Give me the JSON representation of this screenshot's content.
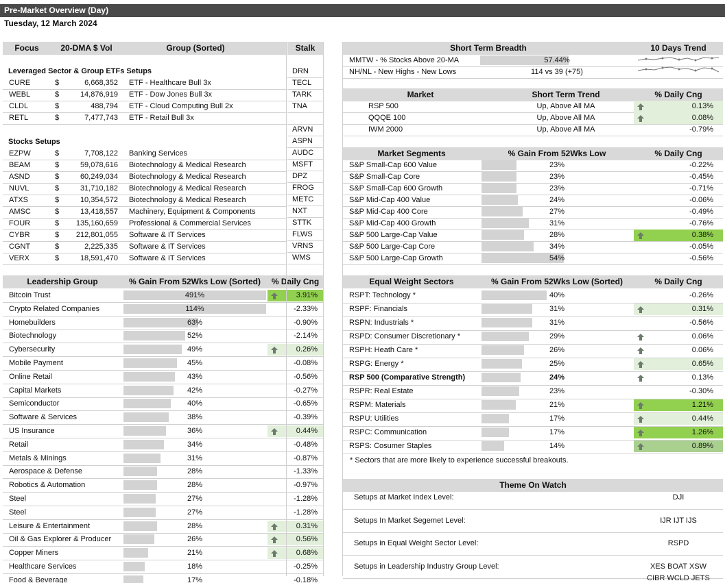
{
  "title": "Pre-Market Overview (Day)",
  "date": "Tuesday, 12 March 2024",
  "focus_table": {
    "headers": {
      "focus": "Focus",
      "vol": "20-DMA $ Vol",
      "group": "Group (Sorted)",
      "stalk": "Stalk"
    },
    "etf_section_title": "Leveraged Sector & Group ETFs Setups",
    "etf_rows": [
      {
        "ticker": "CURE",
        "cur": "$",
        "vol": "6,668,352",
        "group": "ETF - Healthcare Bull 3x"
      },
      {
        "ticker": "WEBL",
        "cur": "$",
        "vol": "14,876,919",
        "group": "ETF - Dow Jones Bull 3x"
      },
      {
        "ticker": "CLDL",
        "cur": "$",
        "vol": "488,794",
        "group": "ETF - Cloud Computing Bull 2x"
      },
      {
        "ticker": "RETL",
        "cur": "$",
        "vol": "7,477,743",
        "group": "ETF - Retail Bull 3x"
      }
    ],
    "stocks_section_title": "Stocks Setups",
    "stock_rows": [
      {
        "ticker": "EZPW",
        "cur": "$",
        "vol": "7,708,122",
        "group": "Banking Services"
      },
      {
        "ticker": "BEAM",
        "cur": "$",
        "vol": "59,078,616",
        "group": "Biotechnology & Medical Research"
      },
      {
        "ticker": "ASND",
        "cur": "$",
        "vol": "60,249,034",
        "group": "Biotechnology & Medical Research"
      },
      {
        "ticker": "NUVL",
        "cur": "$",
        "vol": "31,710,182",
        "group": "Biotechnology & Medical Research"
      },
      {
        "ticker": "ATXS",
        "cur": "$",
        "vol": "10,354,572",
        "group": "Biotechnology & Medical Research"
      },
      {
        "ticker": "AMSC",
        "cur": "$",
        "vol": "13,418,557",
        "group": "Machinery, Equipment & Components"
      },
      {
        "ticker": "FOUR",
        "cur": "$",
        "vol": "135,160,659",
        "group": "Professional & Commercial Services"
      },
      {
        "ticker": "CYBR",
        "cur": "$",
        "vol": "212,801,055",
        "group": "Software & IT Services"
      },
      {
        "ticker": "CGNT",
        "cur": "$",
        "vol": "2,225,335",
        "group": "Software & IT Services"
      },
      {
        "ticker": "VERX",
        "cur": "$",
        "vol": "18,591,470",
        "group": "Software & IT Services"
      }
    ],
    "stalk": [
      "DRN",
      "TECL",
      "TARK",
      "TNA",
      "",
      "ARVN",
      "ASPN",
      "AUDC",
      "MSFT",
      "DPZ",
      "FROG",
      "METC",
      "NXT",
      "STTK",
      "FLWS",
      "VRNS",
      "WMS"
    ]
  },
  "breadth": {
    "title": "Short Term Breadth",
    "trend_title": "10 Days Trend",
    "rows": [
      {
        "label": "MMTW - % Stocks Above 20-MA",
        "value": "57.44%",
        "fill": 0.5744
      },
      {
        "label": "NH/NL - New Highs - New Lows",
        "value": "114 vs 39 (+75)",
        "fill": 0
      }
    ]
  },
  "market": {
    "headers": {
      "market": "Market",
      "trend": "Short Term Trend",
      "cng": "% Daily Cng"
    },
    "rows": [
      {
        "name": "RSP 500",
        "trend": "Up, Above All MA",
        "cng": "0.13%",
        "up": true,
        "shade": "light"
      },
      {
        "name": "QQQE 100",
        "trend": "Up, Above All MA",
        "cng": "0.08%",
        "up": true,
        "shade": "light"
      },
      {
        "name": "IWM 2000",
        "trend": "Up, Above All MA",
        "cng": "-0.79%",
        "up": false,
        "shade": ""
      }
    ]
  },
  "segments": {
    "headers": {
      "name": "Market Segments",
      "gain": "% Gain From 52Wks Low",
      "cng": "% Daily Cng"
    },
    "rows": [
      {
        "name": "S&P Small-Cap 600 Value",
        "gain": "23%",
        "gain_num": 23,
        "cng": "-0.22%",
        "up": false,
        "shade": ""
      },
      {
        "name": "S&P Small-Cap Core",
        "gain": "23%",
        "gain_num": 23,
        "cng": "-0.45%",
        "up": false,
        "shade": ""
      },
      {
        "name": "S&P Small-Cap 600 Growth",
        "gain": "23%",
        "gain_num": 23,
        "cng": "-0.71%",
        "up": false,
        "shade": ""
      },
      {
        "name": "S&P Mid-Cap 400 Value",
        "gain": "24%",
        "gain_num": 24,
        "cng": "-0.06%",
        "up": false,
        "shade": ""
      },
      {
        "name": "S&P Mid-Cap 400 Core",
        "gain": "27%",
        "gain_num": 27,
        "cng": "-0.49%",
        "up": false,
        "shade": ""
      },
      {
        "name": "S&P Mid-Cap 400 Growth",
        "gain": "31%",
        "gain_num": 31,
        "cng": "-0.76%",
        "up": false,
        "shade": ""
      },
      {
        "name": "S&P 500 Large-Cap Value",
        "gain": "28%",
        "gain_num": 28,
        "cng": "0.38%",
        "up": true,
        "shade": "strong"
      },
      {
        "name": "S&P 500 Large-Cap Core",
        "gain": "34%",
        "gain_num": 34,
        "cng": "-0.05%",
        "up": false,
        "shade": ""
      },
      {
        "name": "S&P 500 Large-Cap Growth",
        "gain": "54%",
        "gain_num": 54,
        "cng": "-0.56%",
        "up": false,
        "shade": ""
      }
    ]
  },
  "leadership": {
    "headers": {
      "name": "Leadership Group",
      "gain": "% Gain From 52Wks Low (Sorted)",
      "cng": "% Daily Cng"
    },
    "rows": [
      {
        "name": "Bitcoin Trust",
        "gain": "491%",
        "gain_num": 491,
        "cng": "3.91%",
        "up": true,
        "shade": "strong"
      },
      {
        "name": "Crypto Related Companies",
        "gain": "114%",
        "gain_num": 114,
        "cng": "-2.33%",
        "up": false,
        "shade": ""
      },
      {
        "name": "Homebuilders",
        "gain": "63%",
        "gain_num": 63,
        "cng": "-0.90%",
        "up": false,
        "shade": ""
      },
      {
        "name": "Biotechnology",
        "gain": "52%",
        "gain_num": 52,
        "cng": "-2.14%",
        "up": false,
        "shade": ""
      },
      {
        "name": "Cybersecurity",
        "gain": "49%",
        "gain_num": 49,
        "cng": "0.26%",
        "up": true,
        "shade": "light"
      },
      {
        "name": "Mobile Payment",
        "gain": "45%",
        "gain_num": 45,
        "cng": "-0.08%",
        "up": false,
        "shade": ""
      },
      {
        "name": "Online Retail",
        "gain": "43%",
        "gain_num": 43,
        "cng": "-0.56%",
        "up": false,
        "shade": ""
      },
      {
        "name": "Capital Markets",
        "gain": "42%",
        "gain_num": 42,
        "cng": "-0.27%",
        "up": false,
        "shade": ""
      },
      {
        "name": "Semiconductor",
        "gain": "40%",
        "gain_num": 40,
        "cng": "-0.65%",
        "up": false,
        "shade": ""
      },
      {
        "name": "Software & Services",
        "gain": "38%",
        "gain_num": 38,
        "cng": "-0.39%",
        "up": false,
        "shade": ""
      },
      {
        "name": "US Insurance",
        "gain": "36%",
        "gain_num": 36,
        "cng": "0.44%",
        "up": true,
        "shade": "light"
      },
      {
        "name": "Retail",
        "gain": "34%",
        "gain_num": 34,
        "cng": "-0.48%",
        "up": false,
        "shade": ""
      },
      {
        "name": "Metals & Minings",
        "gain": "31%",
        "gain_num": 31,
        "cng": "-0.87%",
        "up": false,
        "shade": ""
      },
      {
        "name": "Aerospace & Defense",
        "gain": "28%",
        "gain_num": 28,
        "cng": "-1.33%",
        "up": false,
        "shade": ""
      },
      {
        "name": "Robotics & Automation",
        "gain": "28%",
        "gain_num": 28,
        "cng": "-0.97%",
        "up": false,
        "shade": ""
      },
      {
        "name": "Steel",
        "gain": "27%",
        "gain_num": 27,
        "cng": "-1.28%",
        "up": false,
        "shade": ""
      },
      {
        "name": "Steel",
        "gain": "27%",
        "gain_num": 27,
        "cng": "-1.28%",
        "up": false,
        "shade": ""
      },
      {
        "name": "Leisure & Entertainment",
        "gain": "28%",
        "gain_num": 28,
        "cng": "0.31%",
        "up": true,
        "shade": "light"
      },
      {
        "name": "Oil & Gas Explorer & Producer",
        "gain": "26%",
        "gain_num": 26,
        "cng": "0.56%",
        "up": true,
        "shade": "light"
      },
      {
        "name": "Copper Miners",
        "gain": "21%",
        "gain_num": 21,
        "cng": "0.68%",
        "up": true,
        "shade": "light"
      },
      {
        "name": "Healthcare Services",
        "gain": "18%",
        "gain_num": 18,
        "cng": "-0.25%",
        "up": false,
        "shade": ""
      },
      {
        "name": "Food & Beverage",
        "gain": "17%",
        "gain_num": 17,
        "cng": "-0.18%",
        "up": false,
        "shade": ""
      }
    ]
  },
  "sectors": {
    "headers": {
      "name": "Equal Weight Sectors",
      "gain": "% Gain From 52Wks Low (Sorted)",
      "cng": "% Daily Cng"
    },
    "rows": [
      {
        "name": "RSPT:  Technology *",
        "gain": "40%",
        "gain_num": 40,
        "cng": "-0.26%",
        "up": false,
        "shade": "",
        "bold": false
      },
      {
        "name": "RSPF:  Financials",
        "gain": "31%",
        "gain_num": 31,
        "cng": "0.31%",
        "up": true,
        "shade": "light",
        "bold": false
      },
      {
        "name": "RSPN:  Industrials *",
        "gain": "31%",
        "gain_num": 31,
        "cng": "-0.56%",
        "up": false,
        "shade": "",
        "bold": false
      },
      {
        "name": "RSPD:  Consumer Discretionary *",
        "gain": "29%",
        "gain_num": 29,
        "cng": "0.06%",
        "up": true,
        "shade": "",
        "bold": false
      },
      {
        "name": "RSPH:  Heath Care *",
        "gain": "26%",
        "gain_num": 26,
        "cng": "0.06%",
        "up": true,
        "shade": "",
        "bold": false
      },
      {
        "name": "RSPG:  Energy *",
        "gain": "25%",
        "gain_num": 25,
        "cng": "0.65%",
        "up": true,
        "shade": "light",
        "bold": false
      },
      {
        "name": "RSP 500 (Comparative Strength)",
        "gain": "24%",
        "gain_num": 24,
        "cng": "0.13%",
        "up": true,
        "shade": "",
        "bold": true
      },
      {
        "name": "RSPR: Real Estate",
        "gain": "23%",
        "gain_num": 23,
        "cng": "-0.30%",
        "up": false,
        "shade": "",
        "bold": false
      },
      {
        "name": "RSPM:  Materials",
        "gain": "21%",
        "gain_num": 21,
        "cng": "1.21%",
        "up": true,
        "shade": "strong",
        "bold": false
      },
      {
        "name": "RSPU:  Utilities",
        "gain": "17%",
        "gain_num": 17,
        "cng": "0.44%",
        "up": true,
        "shade": "light",
        "bold": false
      },
      {
        "name": "RSPC:  Communication",
        "gain": "17%",
        "gain_num": 17,
        "cng": "1.26%",
        "up": true,
        "shade": "strong",
        "bold": false
      },
      {
        "name": "RSPS:  Cosumer Staples",
        "gain": "14%",
        "gain_num": 14,
        "cng": "0.89%",
        "up": true,
        "shade": "mid",
        "bold": false
      }
    ],
    "footnote": "* Sectors that are more likely to experience successful breakouts."
  },
  "theme": {
    "title": "Theme On Watch",
    "rows": [
      {
        "label": "Setups at Market Index Level:",
        "value": "DJI"
      },
      {
        "label": "Setups In Market Segemet Level:",
        "value": "IJR IJT IJS"
      },
      {
        "label": "Setups in Equal Weight Sector Level:",
        "value": "RSPD"
      },
      {
        "label": "Setups in Leadership Industry Group Level:",
        "value": "XES BOAT XSW"
      }
    ],
    "extra_value": "CIBR WCLD JETS"
  },
  "colors": {
    "header_bg": "#d9d9d9",
    "title_bg": "#4a4a4a",
    "bar": "#d3d3d3",
    "up_light": "#e2efda",
    "up_strong": "#92d050",
    "up_mid": "#a9d08e",
    "arrow": "#6b7b6b"
  }
}
